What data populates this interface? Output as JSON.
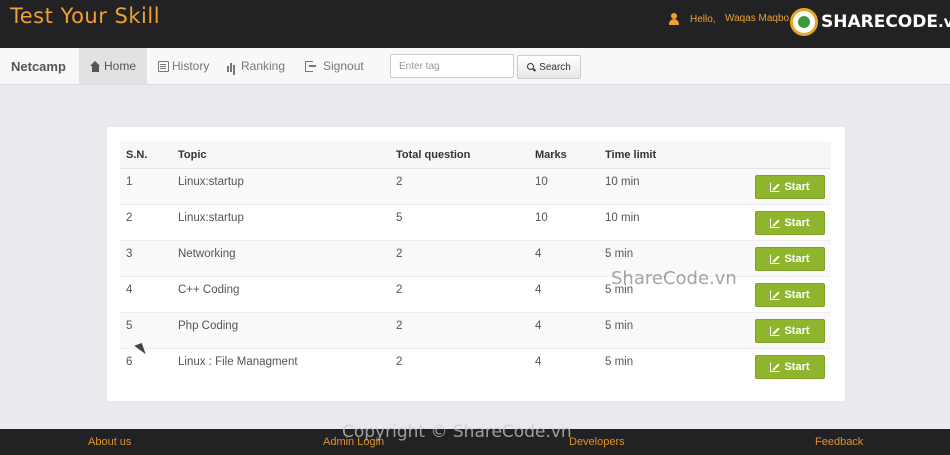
{
  "header": {
    "brand": "Test Your Skill",
    "user_greeting": "Hello,",
    "user_name": "Waqas Maqbo",
    "watermark_logo": "SHARECODE",
    "watermark_logo_suffix": ".vn"
  },
  "nav": {
    "brand": "Netcamp",
    "items": [
      {
        "label": "Home",
        "icon": "home-icon",
        "active": true
      },
      {
        "label": "History",
        "icon": "history-icon",
        "active": false
      },
      {
        "label": "Ranking",
        "icon": "ranking-icon",
        "active": false
      },
      {
        "label": "Signout",
        "icon": "signout-icon",
        "active": false
      }
    ],
    "search": {
      "placeholder": "Enter tag",
      "value": "",
      "button_label": "Search"
    }
  },
  "table": {
    "columns": [
      "S.N.",
      "Topic",
      "Total question",
      "Marks",
      "Time limit"
    ],
    "rows": [
      {
        "sn": "1",
        "topic": "Linux:startup",
        "total": "2",
        "marks": "10",
        "time": "10 min",
        "action": "Start"
      },
      {
        "sn": "2",
        "topic": "Linux:startup",
        "total": "5",
        "marks": "10",
        "time": "10 min",
        "action": "Start"
      },
      {
        "sn": "3",
        "topic": "Networking",
        "total": "2",
        "marks": "4",
        "time": "5 min",
        "action": "Start"
      },
      {
        "sn": "4",
        "topic": "C++ Coding",
        "total": "2",
        "marks": "4",
        "time": "5 min",
        "action": "Start"
      },
      {
        "sn": "5",
        "topic": "Php Coding",
        "total": "2",
        "marks": "4",
        "time": "5 min",
        "action": "Start"
      },
      {
        "sn": "6",
        "topic": "Linux : File Managment",
        "total": "2",
        "marks": "4",
        "time": "5 min",
        "action": "Start"
      }
    ]
  },
  "footer": {
    "links": [
      "About us",
      "Admin Login",
      "Developers",
      "Feedback"
    ]
  },
  "watermarks": {
    "middle": "ShareCode.vn",
    "bottom": "Copyright © ShareCode.vn"
  },
  "colors": {
    "brand": "#f0a030",
    "start_button": "#8fb52c",
    "footer_link": "#e0922a"
  }
}
